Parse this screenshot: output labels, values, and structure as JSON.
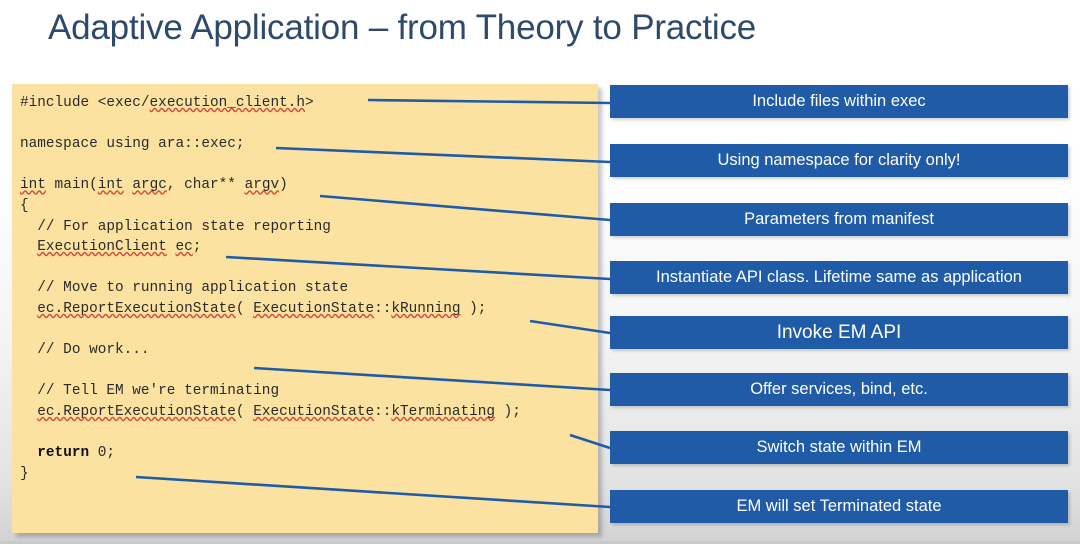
{
  "slide": {
    "title": "Adaptive Application – from Theory to Practice",
    "title_color": "#2e4a6b",
    "background_top_color": "#ffffff",
    "background_bottom_color": "#d2d2d2"
  },
  "code_panel": {
    "background_color": "#fbe2a0",
    "text_color": "#2a2a2a",
    "squiggle_color": "#d84a3a",
    "lines": [
      {
        "id": "l0",
        "text": "#include <exec/execution_client.h>"
      },
      {
        "id": "l1",
        "text": ""
      },
      {
        "id": "l2",
        "text": "namespace using ara::exec;"
      },
      {
        "id": "l3",
        "text": ""
      },
      {
        "id": "l4",
        "text": "int main(int argc, char** argv)"
      },
      {
        "id": "l5",
        "text": "{"
      },
      {
        "id": "l6",
        "text": "  // For application state reporting"
      },
      {
        "id": "l7",
        "text": "  ExecutionClient ec;"
      },
      {
        "id": "l8",
        "text": ""
      },
      {
        "id": "l9",
        "text": "  // Move to running application state"
      },
      {
        "id": "l10",
        "text": "  ec.ReportExecutionState( ExecutionState::kRunning );"
      },
      {
        "id": "l11",
        "text": ""
      },
      {
        "id": "l12",
        "text": "  // Do work..."
      },
      {
        "id": "l13",
        "text": ""
      },
      {
        "id": "l14",
        "text": "  // Tell EM we're terminating"
      },
      {
        "id": "l15",
        "text": "  ec.ReportExecutionState( ExecutionState::kTerminating );"
      },
      {
        "id": "l16",
        "text": ""
      },
      {
        "id": "l17",
        "text": "  return 0;"
      },
      {
        "id": "l18",
        "text": "}"
      }
    ],
    "full_text": "#include <exec/execution_client.h>\n\nnamespace using ara::exec;\n\nint main(int argc, char** argv)\n{\n  // For application state reporting\n  ExecutionClient ec;\n\n  // Move to running application state\n  ec.ReportExecutionState( ExecutionState::kRunning );\n\n  // Do work...\n\n  // Tell EM we're terminating\n  ec.ReportExecutionState( ExecutionState::kTerminating );\n\n  return 0;\n}"
  },
  "callouts": {
    "box_color": "#1f5ba6",
    "text_color": "#ffffff",
    "items": [
      {
        "index": 0,
        "label": "Include files within exec"
      },
      {
        "index": 1,
        "label": "Using namespace for clarity only!"
      },
      {
        "index": 2,
        "label": "Parameters from manifest"
      },
      {
        "index": 3,
        "label": "Instantiate API class. Lifetime same as application"
      },
      {
        "index": 4,
        "label": "Invoke EM API"
      },
      {
        "index": 5,
        "label": "Offer services, bind, etc."
      },
      {
        "index": 6,
        "label": "Switch state within EM"
      },
      {
        "index": 7,
        "label": "EM will set Terminated state"
      }
    ]
  },
  "connectors": {
    "color": "#1f5ba6",
    "width": 2.6,
    "count": 8
  }
}
